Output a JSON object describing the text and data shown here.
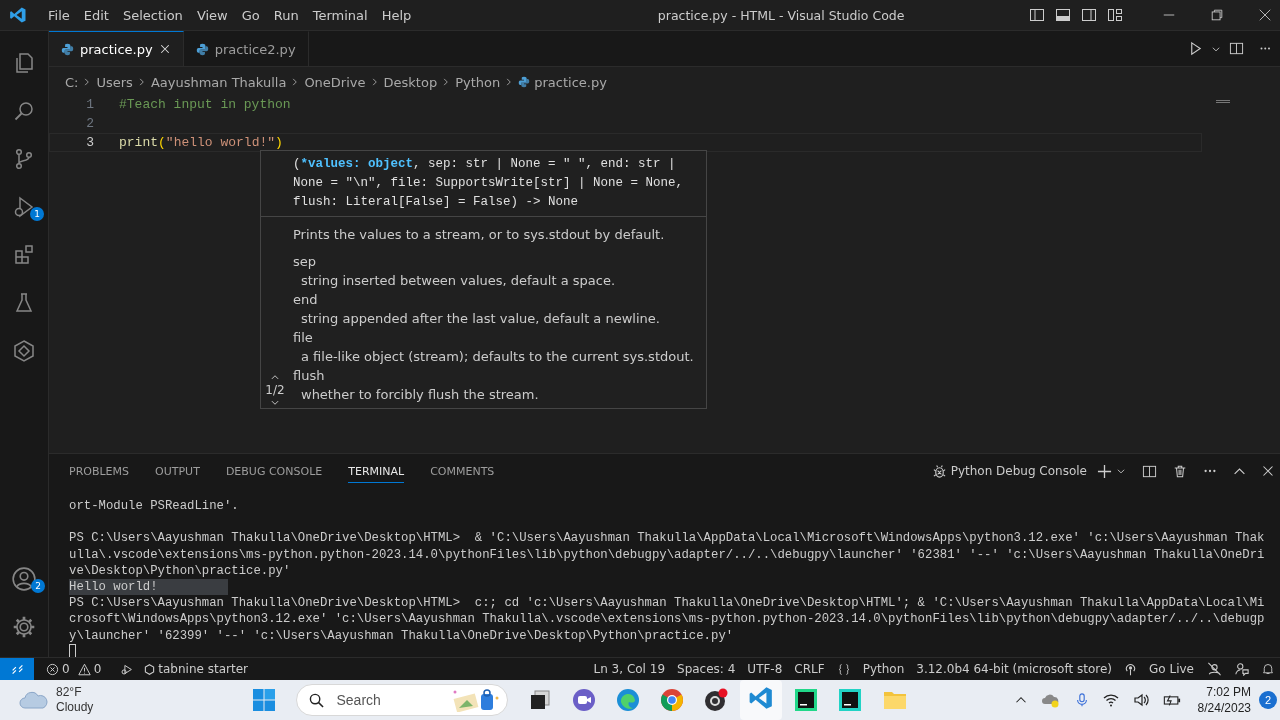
{
  "menu": [
    "File",
    "Edit",
    "Selection",
    "View",
    "Go",
    "Run",
    "Terminal",
    "Help"
  ],
  "window": {
    "title": "practice.py - HTML - Visual Studio Code"
  },
  "activity_bar": [
    {
      "kind": "explorer"
    },
    {
      "kind": "search"
    },
    {
      "kind": "source-control"
    },
    {
      "kind": "run",
      "badge": "1"
    },
    {
      "kind": "extensions"
    },
    {
      "kind": "testing"
    },
    {
      "kind": "remote"
    }
  ],
  "activity_bottom": [
    {
      "kind": "accounts",
      "badge": "2"
    },
    {
      "kind": "settings"
    }
  ],
  "tabs": [
    {
      "label": "practice.py",
      "selected": true
    },
    {
      "label": "practice2.py",
      "selected": false
    }
  ],
  "breadcrumb": [
    {
      "label": "C:",
      "kind": "folder"
    },
    {
      "label": "Users",
      "kind": "folder"
    },
    {
      "label": "Aayushman Thakulla",
      "kind": "folder"
    },
    {
      "label": "OneDrive",
      "kind": "folder"
    },
    {
      "label": "Desktop",
      "kind": "folder"
    },
    {
      "label": "Python",
      "kind": "folder"
    },
    {
      "label": "practice.py",
      "kind": "file"
    }
  ],
  "editor": {
    "lines": [
      {
        "number": "1",
        "current": false,
        "tokens": [
          {
            "kind": "comment",
            "text": "#Teach input in python"
          }
        ]
      },
      {
        "number": "2",
        "current": false
      },
      {
        "number": "3",
        "current": true,
        "tokens": [
          {
            "kind": "func",
            "text": "print"
          },
          {
            "kind": "paren",
            "text": "("
          },
          {
            "kind": "string",
            "text": "\"hello world!\""
          },
          {
            "kind": "paren",
            "text": ")"
          }
        ]
      }
    ]
  },
  "hover": {
    "signature": {
      "before": "(",
      "active_parameter": "*values: object",
      "lines": [
        ", sep: str | None = \" \", end: str |",
        "None = \"\\n\", file: SupportsWrite[str] | None = None,",
        "flush: Literal[False] = False) -> None"
      ]
    },
    "description": "Prints the values to a stream, or to sys.stdout by default.",
    "params": [
      {
        "name": "sep",
        "desc": "string inserted between values, default a space."
      },
      {
        "name": "end",
        "desc": "string appended after the last value, default a newline."
      },
      {
        "name": "file",
        "desc": "a file-like object (stream); defaults to the current sys.stdout."
      },
      {
        "name": "flush",
        "desc": "whether to forcibly flush the stream."
      }
    ],
    "pager": "1/2"
  },
  "panel": {
    "tabs": [
      {
        "label": "PROBLEMS",
        "selected": false
      },
      {
        "label": "OUTPUT",
        "selected": false
      },
      {
        "label": "DEBUG CONSOLE",
        "selected": false
      },
      {
        "label": "TERMINAL",
        "selected": true
      },
      {
        "label": "COMMENTS",
        "selected": false
      }
    ],
    "terminal_name": "Python Debug Console",
    "lines": [
      {
        "text": "ort-Module PSReadLine'.",
        "highlight": false
      },
      {
        "highlight": false
      },
      {
        "text": "PS C:\\Users\\Aayushman Thakulla\\OneDrive\\Desktop\\HTML>  & 'C:\\Users\\Aayushman Thakulla\\AppData\\Local\\Microsoft\\WindowsApps\\python3.12.exe' 'c:\\Users\\Aayushman Thak",
        "highlight": false
      },
      {
        "text": "ulla\\.vscode\\extensions\\ms-python.python-2023.14.0\\pythonFiles\\lib\\python\\debugpy\\adapter/../..\\debugpy\\launcher' '62381' '--' 'c:\\Users\\Aayushman Thakulla\\OneDri",
        "highlight": false
      },
      {
        "text": "ve\\Desktop\\Python\\practice.py'",
        "highlight": false
      },
      {
        "text": "Hello world!",
        "highlight": true
      },
      {
        "text": "PS C:\\Users\\Aayushman Thakulla\\OneDrive\\Desktop\\HTML>  c:; cd 'c:\\Users\\Aayushman Thakulla\\OneDrive\\Desktop\\HTML'; & 'C:\\Users\\Aayushman Thakulla\\AppData\\Local\\Mi",
        "highlight": false
      },
      {
        "text": "crosoft\\WindowsApps\\python3.12.exe' 'c:\\Users\\Aayushman Thakulla\\.vscode\\extensions\\ms-python.python-2023.14.0\\pythonFiles\\lib\\python\\debugpy\\adapter/../..\\debugp",
        "highlight": false
      },
      {
        "text": "y\\launcher' '62399' '--' 'c:\\Users\\Aayushman Thakulla\\OneDrive\\Desktop\\Python\\practice.py'",
        "highlight": false
      }
    ]
  },
  "status_bar": {
    "errors": "0",
    "warnings": "0",
    "tabnine": "tabnine starter",
    "right": [
      {
        "kind": "text",
        "label": "Ln 3, Col 19"
      },
      {
        "kind": "text",
        "label": "Spaces: 4"
      },
      {
        "kind": "text",
        "label": "UTF-8"
      },
      {
        "kind": "text",
        "label": "CRLF"
      },
      {
        "kind": "language",
        "label": "Python"
      },
      {
        "kind": "text",
        "label": "3.12.0b4 64-bit (microsoft store)"
      },
      {
        "kind": "live",
        "label": "Go Live"
      }
    ]
  },
  "taskbar": {
    "temperature": "82°F",
    "condition": "Cloudy",
    "search_placeholder": "Search",
    "time": "7:02 PM",
    "date": "8/24/2023",
    "notifications": "2"
  }
}
